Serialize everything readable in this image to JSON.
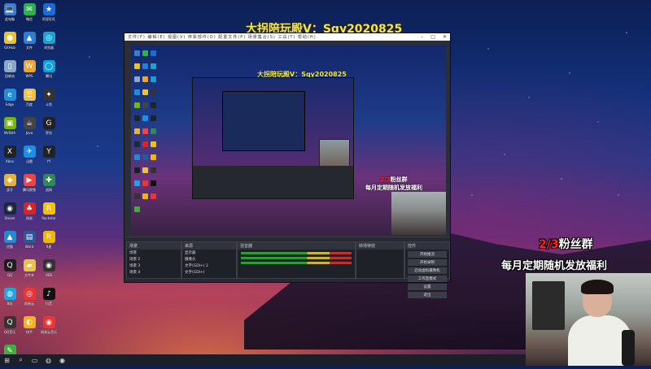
{
  "overlay": {
    "title": "大拐陪玩殿V：Sqy2020825",
    "promo_prefix": "2/3",
    "promo_title": "粉丝群",
    "promo_sub": "每月定期随机发放福利"
  },
  "desktop_icons": [
    {
      "name": "此电脑",
      "glyph": "💻",
      "color": "#3b7bd6"
    },
    {
      "name": "微信",
      "glyph": "✉",
      "color": "#2bb24c"
    },
    {
      "name": "阿里旺旺",
      "glyph": "★",
      "color": "#1a6bd6"
    },
    {
      "name": "GitHub",
      "glyph": "●",
      "color": "#f0c02b"
    },
    {
      "name": "文件",
      "glyph": "▲",
      "color": "#2a7fd4"
    },
    {
      "name": "浏览器",
      "glyph": "◎",
      "color": "#1aa3d0"
    },
    {
      "name": "回收站",
      "glyph": "▯",
      "color": "#8aa8c8"
    },
    {
      "name": "WPS",
      "glyph": "W",
      "color": "#e9a633"
    },
    {
      "name": "腾讯",
      "glyph": "◯",
      "color": "#12a0d8"
    },
    {
      "name": "Edge",
      "glyph": "e",
      "color": "#1a8fdc"
    },
    {
      "name": "百度",
      "glyph": "☰",
      "color": "#f3c03b"
    },
    {
      "name": "斗鱼",
      "glyph": "✦",
      "color": "#333"
    },
    {
      "name": "NVIDIA",
      "glyph": "▣",
      "color": "#76b900"
    },
    {
      "name": "Java",
      "glyph": "☕",
      "color": "#444"
    },
    {
      "name": "罗技",
      "glyph": "G",
      "color": "#222"
    },
    {
      "name": "Xbox",
      "glyph": "X",
      "color": "#222"
    },
    {
      "name": "迅雷",
      "glyph": "✈",
      "color": "#1c8fe6"
    },
    {
      "name": "YY",
      "glyph": "Y",
      "color": "#222"
    },
    {
      "name": "虎牙",
      "glyph": "◆",
      "color": "#e8b23a"
    },
    {
      "name": "腾讯视频",
      "glyph": "▶",
      "color": "#e44"
    },
    {
      "name": "战网",
      "glyph": "✚",
      "color": "#2e8b57"
    },
    {
      "name": "Steam",
      "glyph": "◉",
      "color": "#1b2838"
    },
    {
      "name": "网易",
      "glyph": "♣",
      "color": "#d22"
    },
    {
      "name": "Rockstar",
      "glyph": "R",
      "color": "#f4c200"
    },
    {
      "name": "优酷",
      "glyph": "▲",
      "color": "#1f8ad6"
    },
    {
      "name": "Word",
      "glyph": "▤",
      "color": "#2b579a"
    },
    {
      "name": "R星",
      "glyph": "R",
      "color": "#f0b800"
    },
    {
      "name": "QQ",
      "glyph": "Q",
      "color": "#1f1f1f"
    },
    {
      "name": "文件夹",
      "glyph": "▰",
      "color": "#e8c34a"
    },
    {
      "name": "OBS",
      "glyph": "◉",
      "color": "#333"
    },
    {
      "name": "B站",
      "glyph": "◍",
      "color": "#1aa6e4"
    },
    {
      "name": "网易云",
      "glyph": "◎",
      "color": "#e33"
    },
    {
      "name": "抖音",
      "glyph": "♪",
      "color": "#111"
    },
    {
      "name": "QQ音乐",
      "glyph": "Q",
      "color": "#333"
    },
    {
      "name": "快手",
      "glyph": "◐",
      "color": "#f3b21b"
    },
    {
      "name": "网易云音乐",
      "glyph": "◉",
      "color": "#e33"
    },
    {
      "name": "游戏",
      "glyph": "✎",
      "color": "#3fae3f"
    }
  ],
  "obs": {
    "menu": "文件(F)  编辑(E)  视图(V)  停靠部件(D)  配置文件(P)  场景集合(S)  工具(T)  帮助(H)",
    "preview_title": "大拐陪玩殿V：Sqy2020825",
    "preview_promo_prefix": "2/3",
    "preview_promo_title": "粉丝群",
    "preview_promo_sub": "每月定期随机发放福利",
    "scenes_header": "场景",
    "scenes": [
      "场景",
      "场景 2",
      "场景 3",
      "场景 4"
    ],
    "sources_header": "来源",
    "sources": [
      "显示器",
      "摄像头",
      "文字(GDI+) 2",
      "文字(GDI+)"
    ],
    "mixer_header": "混音器",
    "transitions_header": "转场特效",
    "controls_header": "控件",
    "controls": [
      "开始推流",
      "开始录制",
      "启动虚拟摄像机",
      "工作室模式",
      "设置",
      "退出"
    ]
  },
  "taskbar": {
    "items": [
      "start-icon",
      "search-icon",
      "task-view-icon",
      "edge-icon",
      "obs-icon"
    ]
  }
}
